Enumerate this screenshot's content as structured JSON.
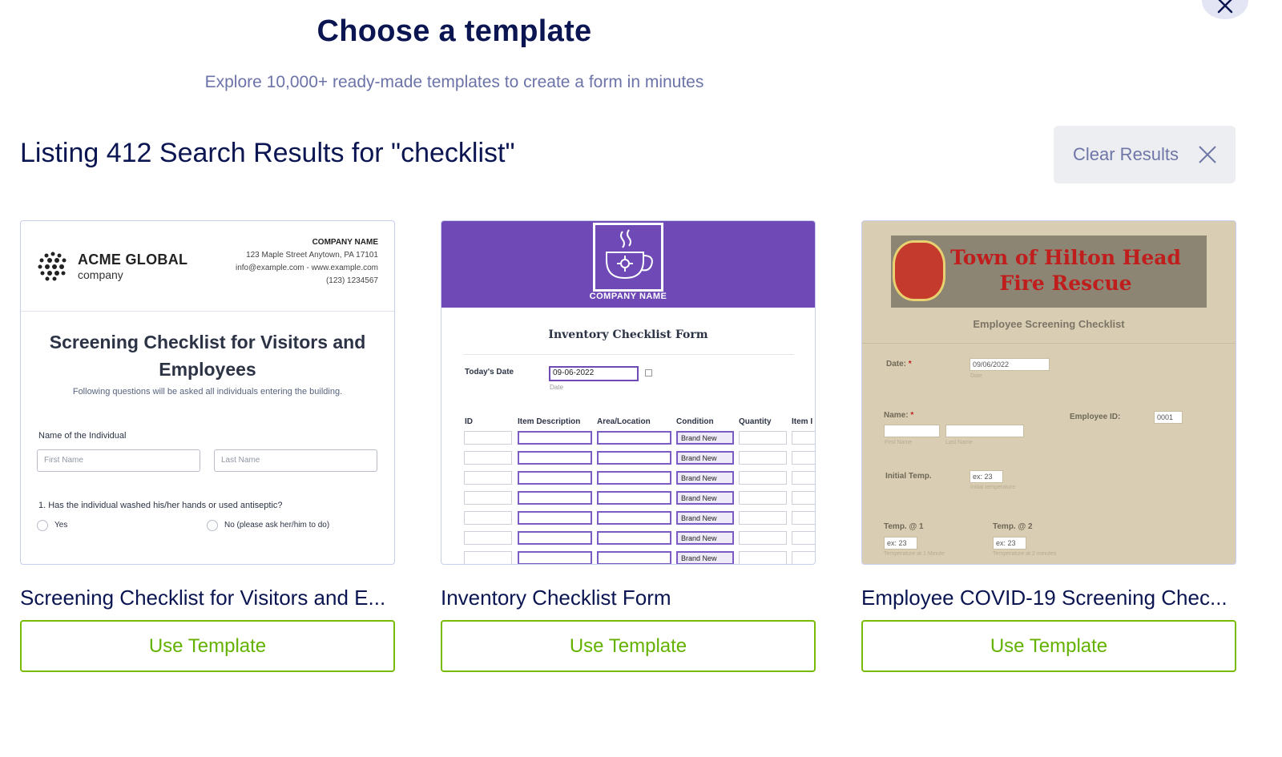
{
  "header": {
    "title": "Choose a template",
    "subtitle": "Explore 10,000+ ready-made templates to create a form in minutes",
    "close_icon": "close-icon"
  },
  "results": {
    "title": "Listing 412 Search Results for \"checklist\"",
    "clear_label": "Clear Results"
  },
  "cards": [
    {
      "title": "Screening Checklist for Visitors and E...",
      "button": "Use Template",
      "preview": {
        "brand_line1": "ACME GLOBAL",
        "brand_line2": "company",
        "company_name": "COMPANY NAME",
        "address": "123 Maple Street Anytown, PA 17101",
        "contact": "info@example.com - www.example.com",
        "phone": "(123) 1234567",
        "form_title": "Screening Checklist for Visitors and Employees",
        "form_desc": "Following questions will be asked all individuals entering the building.",
        "name_label": "Name of the Individual",
        "first_placeholder": "First Name",
        "last_placeholder": "Last Name",
        "question": "1. Has the individual washed his/her hands or used antiseptic?",
        "option_yes": "Yes",
        "option_no": "No (please ask her/him to do)"
      }
    },
    {
      "title": "Inventory Checklist Form",
      "button": "Use Template",
      "preview": {
        "company_name": "COMPANY NAME",
        "form_title": "Inventory Checklist Form",
        "date_label": "Today's Date",
        "date_value": "09-06-2022",
        "date_sub": "Date",
        "columns": [
          "ID",
          "Item Description",
          "Area/Location",
          "Condition",
          "Quantity",
          "Item I"
        ],
        "condition_value": "Brand New",
        "row_count": 7,
        "accent": "#6f4ab7"
      }
    },
    {
      "title": "Employee COVID-19 Screening Chec...",
      "button": "Use Template",
      "preview": {
        "banner_line1": "Town of Hilton Head",
        "banner_line2": "Fire Rescue",
        "subtitle": "Employee Screening Checklist",
        "date_label": "Date:",
        "date_value": "09/06/2022",
        "date_sub": "Date",
        "name_label": "Name:",
        "first_sub": "First Name",
        "last_sub": "Last Name",
        "employee_label": "Employee ID:",
        "employee_value": "0001",
        "temp_label": "Initial Temp.",
        "temp_value": "ex: 23",
        "temp_sub": "Initial temperature",
        "temp1_label": "Temp. @ 1",
        "temp1_value": "ex: 23",
        "temp1_sub": "Temperature at 1 Minute",
        "temp2_label": "Temp. @ 2",
        "temp2_value": "ex: 23",
        "temp2_sub": "Temperature at 2 minutes"
      }
    }
  ],
  "colors": {
    "navy": "#0a1551",
    "green": "#78bb07",
    "purple": "#6f4ab7",
    "muted": "#6c73a8"
  }
}
